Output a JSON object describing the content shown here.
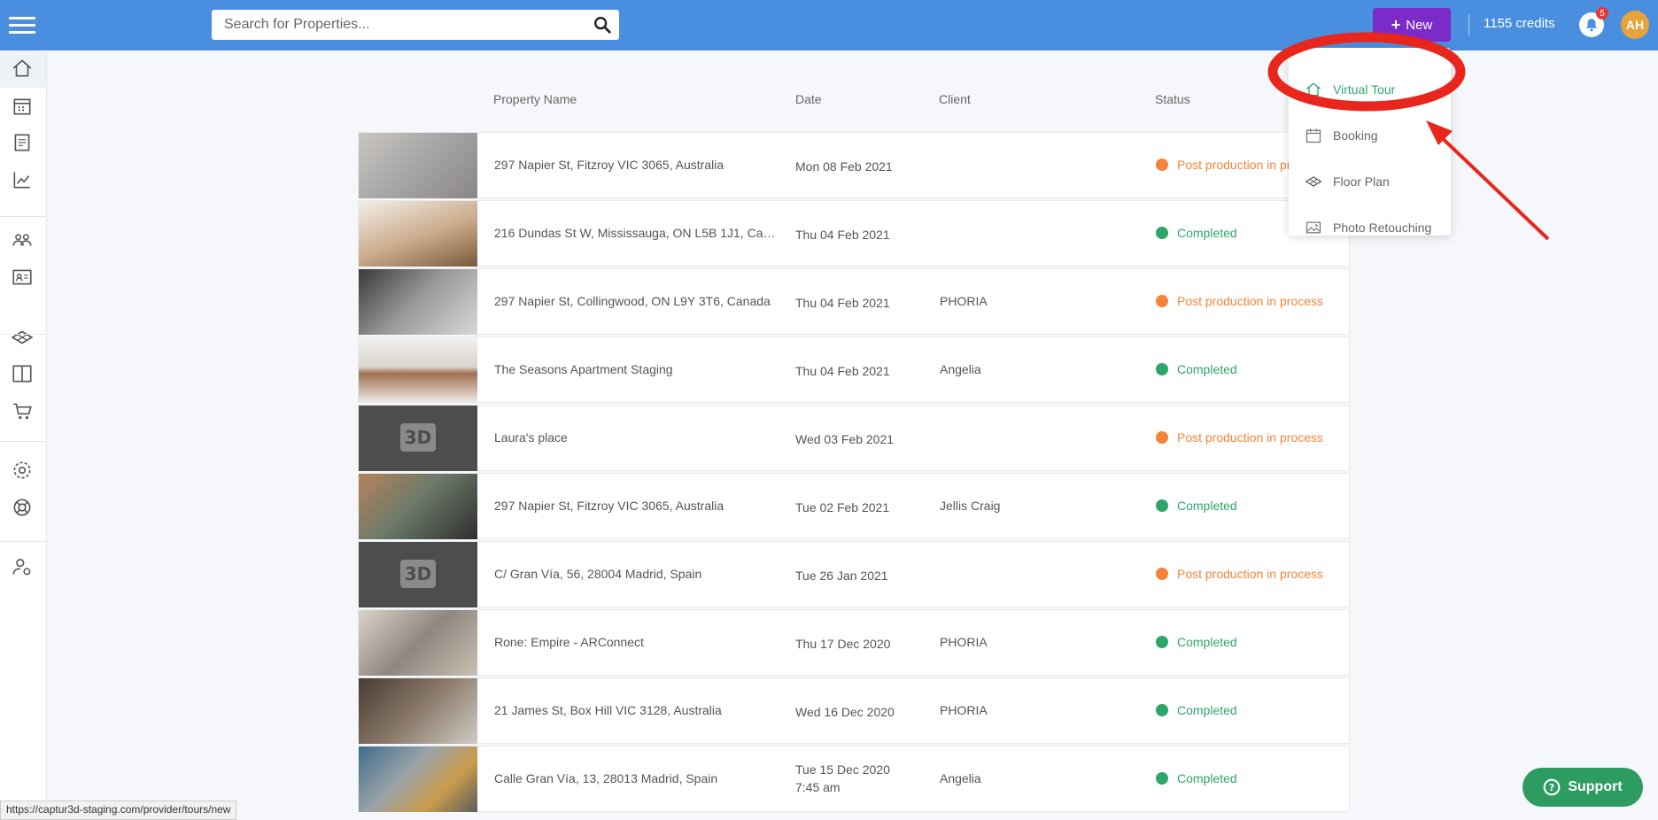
{
  "search": {
    "placeholder": "Search for Properties..."
  },
  "header": {
    "new_label": "New",
    "credits": "1155 credits",
    "notification_count": "5",
    "avatar_initials": "AH"
  },
  "table": {
    "columns": [
      "Property Name",
      "Date",
      "Client",
      "Status"
    ],
    "rows": [
      {
        "name": "297 Napier St, Fitzroy VIC 3065, Australia",
        "date": "Mon 08 Feb 2021",
        "client": "",
        "status": "Post production in process"
      },
      {
        "name": "216 Dundas St W, Mississauga, ON L5B 1J1, Can...",
        "date": "Thu 04 Feb 2021",
        "client": "",
        "status": "Completed"
      },
      {
        "name": "297 Napier St, Collingwood, ON L9Y 3T6, Canada",
        "date": "Thu 04 Feb 2021",
        "client": "PHORIA",
        "status": "Post production in process"
      },
      {
        "name": "The Seasons Apartment Staging",
        "date": "Thu 04 Feb 2021",
        "client": "Angelia",
        "status": "Completed"
      },
      {
        "name": "Laura's place",
        "date": "Wed 03 Feb 2021",
        "client": "",
        "status": "Post production in process"
      },
      {
        "name": "297 Napier St, Fitzroy VIC 3065, Australia",
        "date": "Tue 02 Feb 2021",
        "client": "Jellis Craig",
        "status": "Completed"
      },
      {
        "name": "C/ Gran Vía, 56, 28004 Madrid, Spain",
        "date": "Tue 26 Jan 2021",
        "client": "",
        "status": "Post production in process"
      },
      {
        "name": "Rone: Empire - ARConnect",
        "date": "Thu 17 Dec 2020",
        "client": "PHORIA",
        "status": "Completed"
      },
      {
        "name": "21 James St, Box Hill VIC 3128, Australia",
        "date": "Wed 16 Dec 2020",
        "client": "PHORIA",
        "status": "Completed"
      },
      {
        "name": "Calle Gran Vía, 13, 28013 Madrid, Spain",
        "date": "Tue 15 Dec 2020",
        "date_time": "7:45 am",
        "client": "Angelia",
        "status": "Completed"
      }
    ]
  },
  "thumbnails": [
    "photo",
    "photo",
    "photo",
    "photo",
    "3d-placeholder",
    "photo",
    "3d-placeholder",
    "photo",
    "photo",
    "photo"
  ],
  "placeholder_3d_label": "3D",
  "dropdown": {
    "items": [
      "Virtual Tour",
      "Booking",
      "Floor Plan",
      "Photo Retouching"
    ]
  },
  "support_label": "Support",
  "status_url": "https://captur3d-staging.com/provider/tours/new",
  "colors": {
    "topbar": "#4a8fdf",
    "new_button": "#7b2bc7",
    "completed": "#2ea56b",
    "in_process": "#f5843a",
    "annotation": "#e8261c"
  }
}
